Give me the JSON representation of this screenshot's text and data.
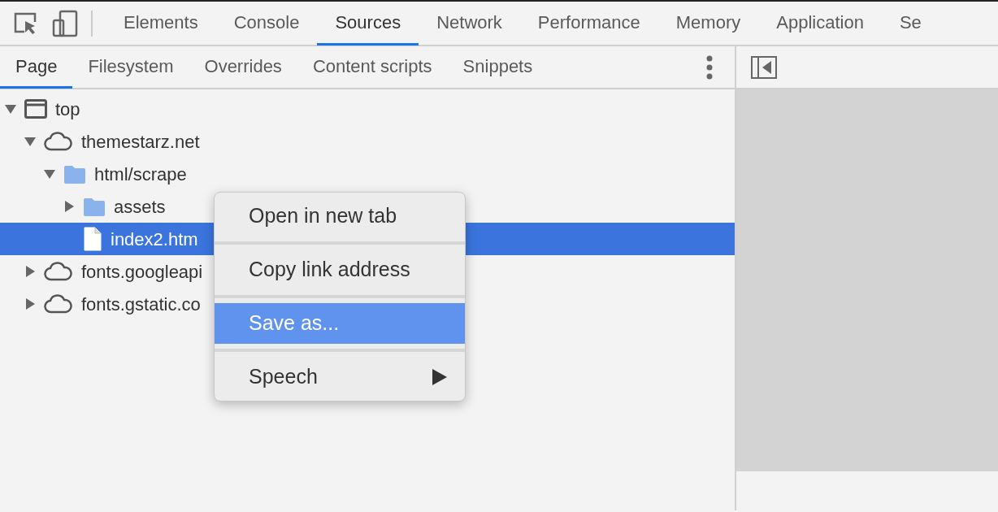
{
  "main_tabs": [
    {
      "label": "Elements",
      "selected": false
    },
    {
      "label": "Console",
      "selected": false
    },
    {
      "label": "Sources",
      "selected": true
    },
    {
      "label": "Network",
      "selected": false
    },
    {
      "label": "Performance",
      "selected": false
    },
    {
      "label": "Memory",
      "selected": false
    },
    {
      "label": "Application",
      "selected": false
    },
    {
      "label": "Se",
      "selected": false
    }
  ],
  "navigator_tabs": [
    {
      "label": "Page",
      "selected": true
    },
    {
      "label": "Filesystem",
      "selected": false
    },
    {
      "label": "Overrides",
      "selected": false
    },
    {
      "label": "Content scripts",
      "selected": false
    },
    {
      "label": "Snippets",
      "selected": false
    }
  ],
  "tree": [
    {
      "kind": "frame",
      "label": "top",
      "expanded": true,
      "selected": false,
      "children": [
        {
          "kind": "domain",
          "label": "themestarz.net",
          "expanded": true,
          "selected": false,
          "children": [
            {
              "kind": "folder",
              "label": "html/scrape",
              "expanded": true,
              "selected": false,
              "children": [
                {
                  "kind": "folder",
                  "label": "assets",
                  "expanded": false,
                  "selected": false
                },
                {
                  "kind": "file",
                  "label": "index2.htm",
                  "selected": true
                }
              ]
            }
          ]
        },
        {
          "kind": "domain",
          "label": "fonts.googleapi",
          "expanded": false,
          "selected": false
        },
        {
          "kind": "domain",
          "label": "fonts.gstatic.co",
          "expanded": false,
          "selected": false
        }
      ]
    }
  ],
  "context_menu": [
    {
      "label": "Open in new tab",
      "selected": false
    },
    {
      "label": "Copy link address",
      "selected": false
    },
    {
      "label": "Save as...",
      "selected": true
    },
    {
      "label": "Speech",
      "selected": false,
      "submenu": true
    }
  ]
}
